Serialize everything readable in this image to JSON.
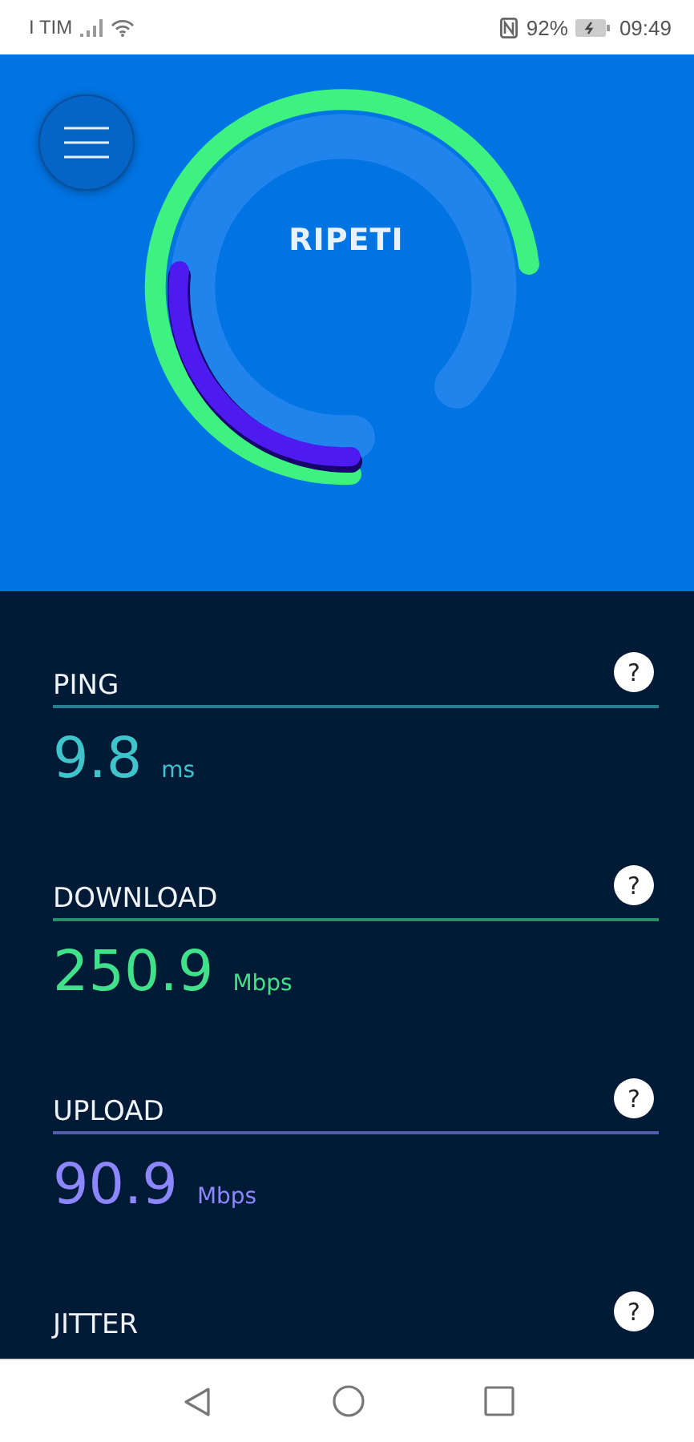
{
  "status_bar": {
    "carrier": "I TIM",
    "battery": "92%",
    "time": "09:49"
  },
  "hero": {
    "button": "RIPETI"
  },
  "metrics": [
    {
      "label": "PING",
      "help": "?",
      "value": "9.8",
      "unit": "ms",
      "color": "#3fc4cc"
    },
    {
      "label": "DOWNLOAD",
      "help": "?",
      "value": "250.9",
      "unit": "Mbps",
      "color": "#41e08a"
    },
    {
      "label": "UPLOAD",
      "help": "?",
      "value": "90.9",
      "unit": "Mbps",
      "color": "#8c86ff"
    },
    {
      "label": "JITTER",
      "help": "?"
    }
  ]
}
